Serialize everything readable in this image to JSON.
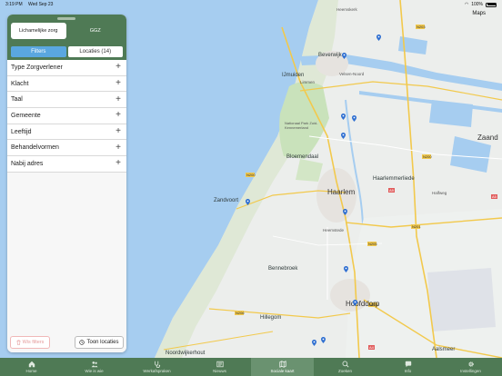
{
  "status": {
    "time": "3:19 PM",
    "date": "Wed Sep 23",
    "battery": "100%"
  },
  "map": {
    "attribution": "Maps",
    "places": {
      "heemskerk": "Heemskerk",
      "beverwijk": "Beverwijk",
      "velsen_noord": "Velsen-Noord",
      "ijmuiden": "IJmuiden",
      "limmen": "Limmen",
      "zaandam": "Zaand",
      "bloemendaal": "Bloemendaal",
      "haarlem": "Haarlem",
      "haarlemmerliede": "Haarlemmerliede",
      "halfweg": "Halfweg",
      "zandvoort": "Zandvoort",
      "heemstede": "Heemstede",
      "bennebroek": "Bennebroek",
      "hoofddorp": "Hoofddorp",
      "hillegom": "Hillegom",
      "aalsmeer": "Aalsmeer",
      "noordwijkerhout": "Noordwijkerhout",
      "park": "Nationaal Park Zuid-Kennemerland"
    },
    "roads": [
      "N203",
      "N202",
      "N200",
      "N201",
      "N206",
      "N205",
      "A9",
      "A4",
      "A5",
      "N208",
      "A10",
      "N231"
    ]
  },
  "panel": {
    "segment_primary": {
      "left": "Lichamelijke zorg",
      "right": "GGZ"
    },
    "segment_secondary": {
      "left": "Filters",
      "right": "Locaties (14)"
    },
    "filters": [
      "Type Zorgverlener",
      "Klacht",
      "Taal",
      "Gemeente",
      "Leeftijd",
      "Behandelvormen",
      "Nabij adres"
    ],
    "clear_label": "Wis filters",
    "show_label": "Toon locaties"
  },
  "tabs": [
    {
      "label": "Home",
      "icon": "home-icon"
    },
    {
      "label": "Wie is wie",
      "icon": "people-icon"
    },
    {
      "label": "Werkafspraken",
      "icon": "stethoscope-icon"
    },
    {
      "label": "Nieuws",
      "icon": "newspaper-icon"
    },
    {
      "label": "Sociale kaart",
      "icon": "map-icon"
    },
    {
      "label": "Zoeken",
      "icon": "search-icon"
    },
    {
      "label": "Info",
      "icon": "chat-icon"
    },
    {
      "label": "Instellingen",
      "icon": "gear-icon"
    }
  ],
  "selected_tab": "Sociale kaart",
  "colors": {
    "brand_green": "#4f7a55",
    "accent_blue": "#5aa7e0",
    "water": "#a6cdf0",
    "land": "#eceeec",
    "dunes": "#d8e8cf",
    "clear_red": "#e49a9a"
  }
}
